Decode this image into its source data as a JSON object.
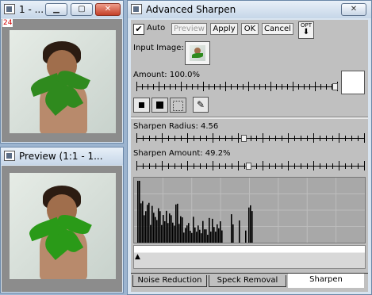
{
  "doc_window": {
    "title": "1 - ...",
    "badge": "24"
  },
  "preview_window": {
    "title": "Preview (1:1 - 1..."
  },
  "dialog": {
    "title": "Advanced Sharpen",
    "auto_label": "Auto",
    "auto_checked": true,
    "preview_btn": "Preview",
    "apply_btn": "Apply",
    "ok_btn": "OK",
    "cancel_btn": "Cancel",
    "opt_btn": "OPT",
    "input_image_label": "Input Image:",
    "amount_label": "Amount: 100.0%",
    "amount_value": 1.0,
    "radius_label": "Sharpen Radius: 4.56",
    "radius_value": 0.47,
    "sharpen_amount_label": "Sharpen Amount: 49.2%",
    "sharpen_amount_value": 0.492,
    "tabs": [
      "Noise Reduction",
      "Speck Removal",
      "Sharpen"
    ],
    "active_tab": "Sharpen"
  },
  "icons": {
    "minimize": "minimize-icon",
    "maximize": "maximize-icon",
    "close": "close-icon",
    "eyedropper": "eyedropper-icon"
  }
}
